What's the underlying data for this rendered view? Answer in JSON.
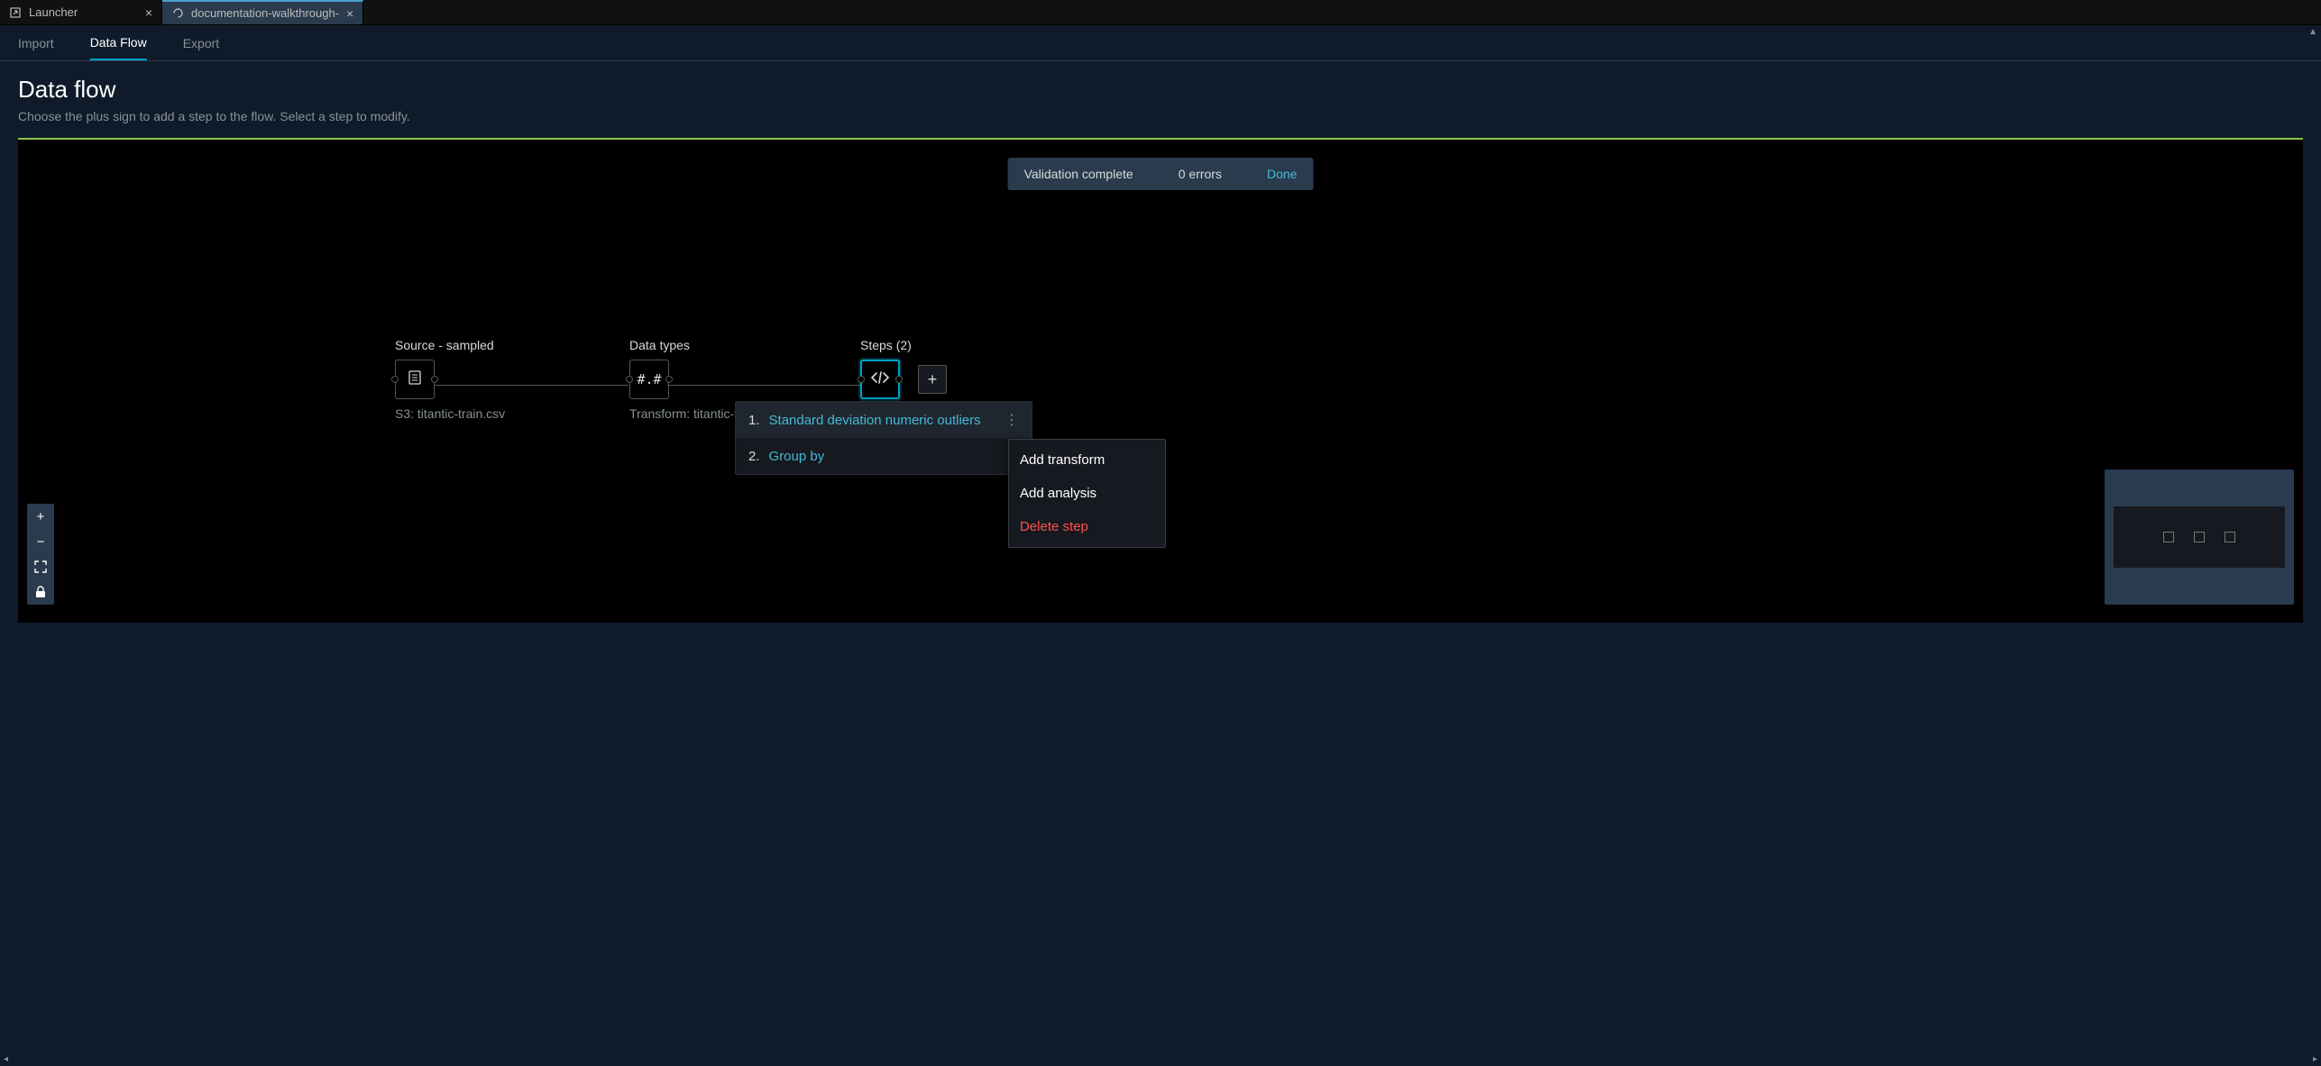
{
  "tabs": [
    {
      "label": "Launcher",
      "active": false,
      "icon": "launcher"
    },
    {
      "label": "documentation-walkthrough-",
      "active": true,
      "icon": "flow"
    }
  ],
  "subnav": {
    "items": [
      {
        "label": "Import",
        "active": false
      },
      {
        "label": "Data Flow",
        "active": true
      },
      {
        "label": "Export",
        "active": false
      }
    ]
  },
  "header": {
    "title": "Data flow",
    "subtitle": "Choose the plus sign to add a step to the flow. Select a step to modify."
  },
  "toast": {
    "message": "Validation complete",
    "errors": "0 errors",
    "action": "Done"
  },
  "nodes": {
    "source": {
      "title": "Source - sampled",
      "sub": "S3: titantic-train.csv",
      "icon": "dataset"
    },
    "types": {
      "title": "Data types",
      "sub": "Transform: titantic-t",
      "icon": "#.#"
    },
    "steps": {
      "title": "Steps (2)",
      "sub": "",
      "icon": "code"
    }
  },
  "add_button": "+",
  "steps_popover": [
    {
      "num": "1.",
      "name": "Standard deviation numeric outliers"
    },
    {
      "num": "2.",
      "name": "Group by"
    }
  ],
  "context_menu": [
    {
      "label": "Add transform",
      "danger": false
    },
    {
      "label": "Add analysis",
      "danger": false
    },
    {
      "label": "Delete step",
      "danger": true
    }
  ],
  "zoom": {
    "in": "+",
    "out": "−",
    "fullscreen": "⛶",
    "lock": "🔒"
  },
  "colors": {
    "accent": "#00a1c9",
    "accent_line": "#8bc34a",
    "danger": "#ff5252",
    "panel": "#2a3b4d",
    "bg": "#0f1b2a"
  }
}
